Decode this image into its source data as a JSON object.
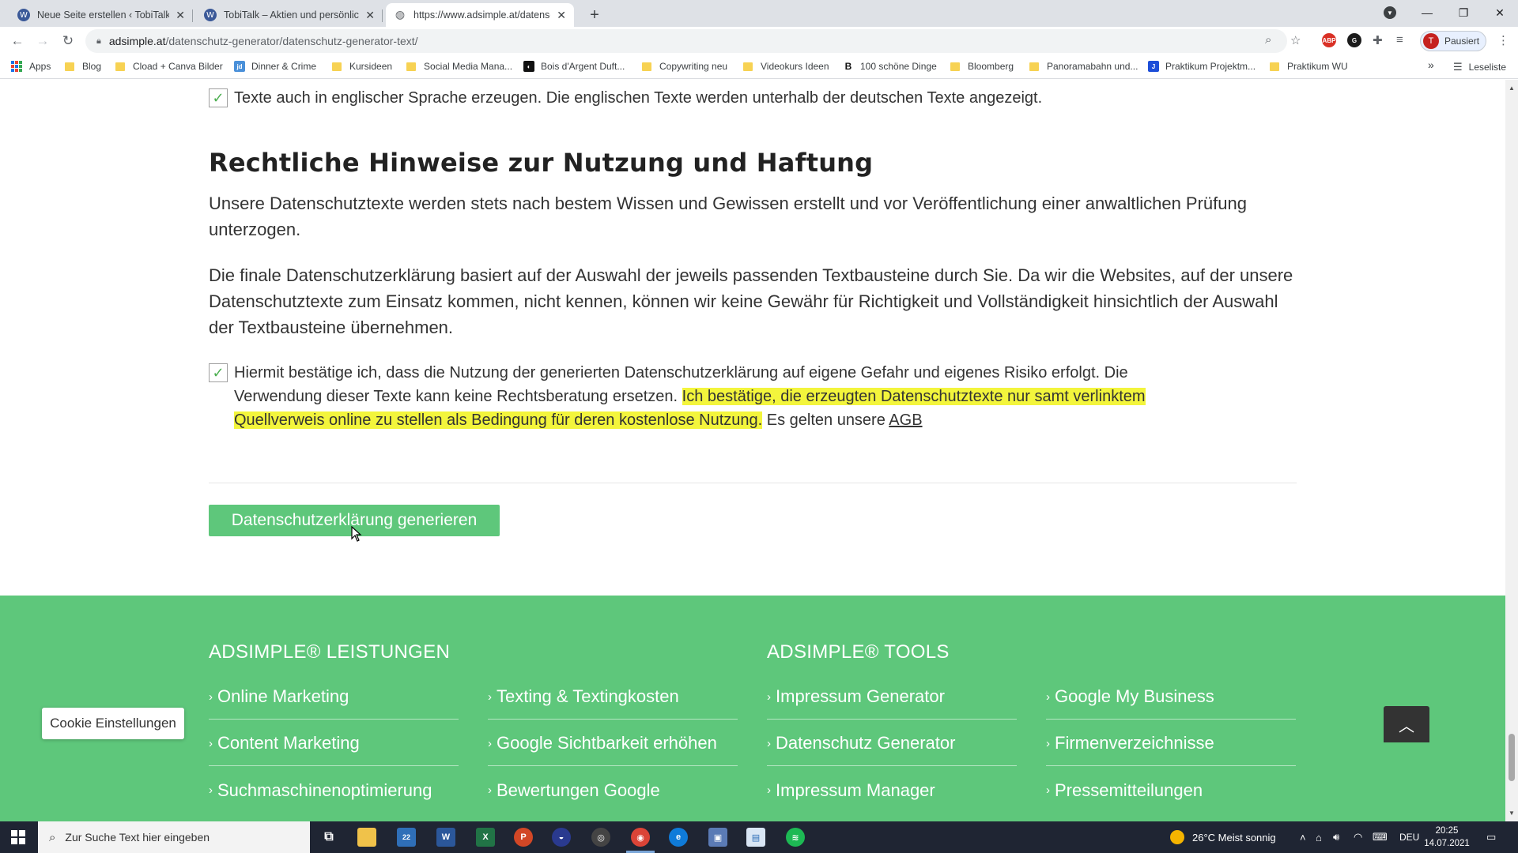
{
  "browser": {
    "tabs": [
      {
        "title": "Neue Seite erstellen ‹ TobiTalk —",
        "favicon": "W",
        "active": false
      },
      {
        "title": "TobiTalk – Aktien und persönliche",
        "favicon": "W",
        "active": false
      },
      {
        "title": "https://www.adsimple.at/datensc",
        "favicon": "globe-icon",
        "active": true
      }
    ],
    "url_host": "adsimple.at",
    "url_path": "/datenschutz-generator/datenschutz-generator-text/",
    "profile_initial": "T",
    "profile_label": "Pausiert",
    "bookmarks": [
      {
        "label": "Apps"
      },
      {
        "label": "Blog"
      },
      {
        "label": "Cload + Canva Bilder"
      },
      {
        "label": "Dinner & Crime"
      },
      {
        "label": "Kursideen"
      },
      {
        "label": "Social Media Mana..."
      },
      {
        "label": "Bois d'Argent Duft..."
      },
      {
        "label": "Copywriting neu"
      },
      {
        "label": "Videokurs Ideen"
      },
      {
        "label": "100 schöne Dinge"
      },
      {
        "label": "Bloomberg"
      },
      {
        "label": "Panoramabahn und..."
      },
      {
        "label": "Praktikum Projektm..."
      },
      {
        "label": "Praktikum WU"
      }
    ],
    "bookmarks_more": "»",
    "reading_list": "Leseliste"
  },
  "page": {
    "english_checkbox_label": "Texte auch in englischer Sprache erzeugen. Die englischen Texte werden unterhalb der deutschen Texte angezeigt.",
    "section_title": "Rechtliche Hinweise zur Nutzung und Haftung",
    "paragraph1": "Unsere Datenschutztexte werden stets nach bestem Wissen und Gewissen erstellt und vor Veröffentlichung einer anwaltlichen Prüfung unterzogen.",
    "paragraph2": "Die finale Datenschutzerklärung basiert auf der Auswahl der jeweils passenden Textbausteine durch Sie. Da wir die Websites, auf der unsere Datenschutztexte zum Einsatz kommen, nicht kennen, können wir keine Gewähr für Richtigkeit und Vollständigkeit hinsichtlich der Auswahl der Textbausteine übernehmen.",
    "confirm_text": "Hiermit bestätige ich, dass die Nutzung der generierten Datenschutzerklärung auf eigene Gefahr und eigenes Risiko erfolgt. Die Verwendung dieser Texte kann keine Rechtsberatung ersetzen.",
    "confirm_highlight": "Ich bestätige, die erzeugten Datenschutztexte nur samt verlinktem Quellverweis online zu stellen als Bedingung für deren kostenlose Nutzung.",
    "confirm_agb_prefix": " Es gelten unsere ",
    "confirm_agb_link": "AGB",
    "generate_button": "Datenschutzerklärung generieren",
    "checkbox_mark": "✓"
  },
  "footer": {
    "leistungen_title": "ADSIMPLE® LEISTUNGEN",
    "tools_title": "ADSIMPLE® TOOLS",
    "col1": [
      "Online Marketing",
      "Content Marketing",
      "Suchmaschinenoptimierung"
    ],
    "col2": [
      "Texting & Textingkosten",
      "Google Sichtbarkeit erhöhen",
      "Bewertungen Google"
    ],
    "col3": [
      "Impressum Generator",
      "Datenschutz Generator",
      "Impressum Manager"
    ],
    "col4": [
      "Google My Business",
      "Firmenverzeichnisse",
      "Pressemitteilungen"
    ],
    "cookie_button": "Cookie Einstellungen"
  },
  "taskbar": {
    "search_placeholder": "Zur Suche Text hier eingeben",
    "mail_badge": "22",
    "weather": "26°C  Meist sonnig",
    "language": "DEU",
    "time": "20:25",
    "date": "14.07.2021"
  },
  "colors": {
    "brand_green": "#5ec77b",
    "highlight_yellow": "#f3f53c",
    "taskbar": "#1f2533"
  }
}
